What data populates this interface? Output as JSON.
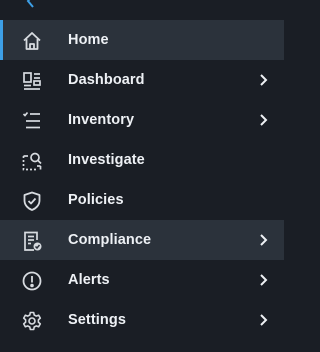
{
  "colors": {
    "background": "#1a1e25",
    "active_background": "#2b323b",
    "accent": "#3d9fe6",
    "text": "#eef1f5",
    "icon": "#d7dbe0"
  },
  "nav": {
    "items": [
      {
        "label": "Home",
        "icon": "home-icon",
        "has_submenu": false,
        "active": true
      },
      {
        "label": "Dashboard",
        "icon": "dashboard-icon",
        "has_submenu": true
      },
      {
        "label": "Inventory",
        "icon": "checklist-icon",
        "has_submenu": true
      },
      {
        "label": "Investigate",
        "icon": "investigate-icon",
        "has_submenu": false
      },
      {
        "label": "Policies",
        "icon": "shield-check-icon",
        "has_submenu": false
      },
      {
        "label": "Compliance",
        "icon": "compliance-report-icon",
        "has_submenu": true,
        "highlighted": true
      },
      {
        "label": "Alerts",
        "icon": "alert-circle-icon",
        "has_submenu": true
      },
      {
        "label": "Settings",
        "icon": "gear-icon",
        "has_submenu": true
      }
    ]
  }
}
